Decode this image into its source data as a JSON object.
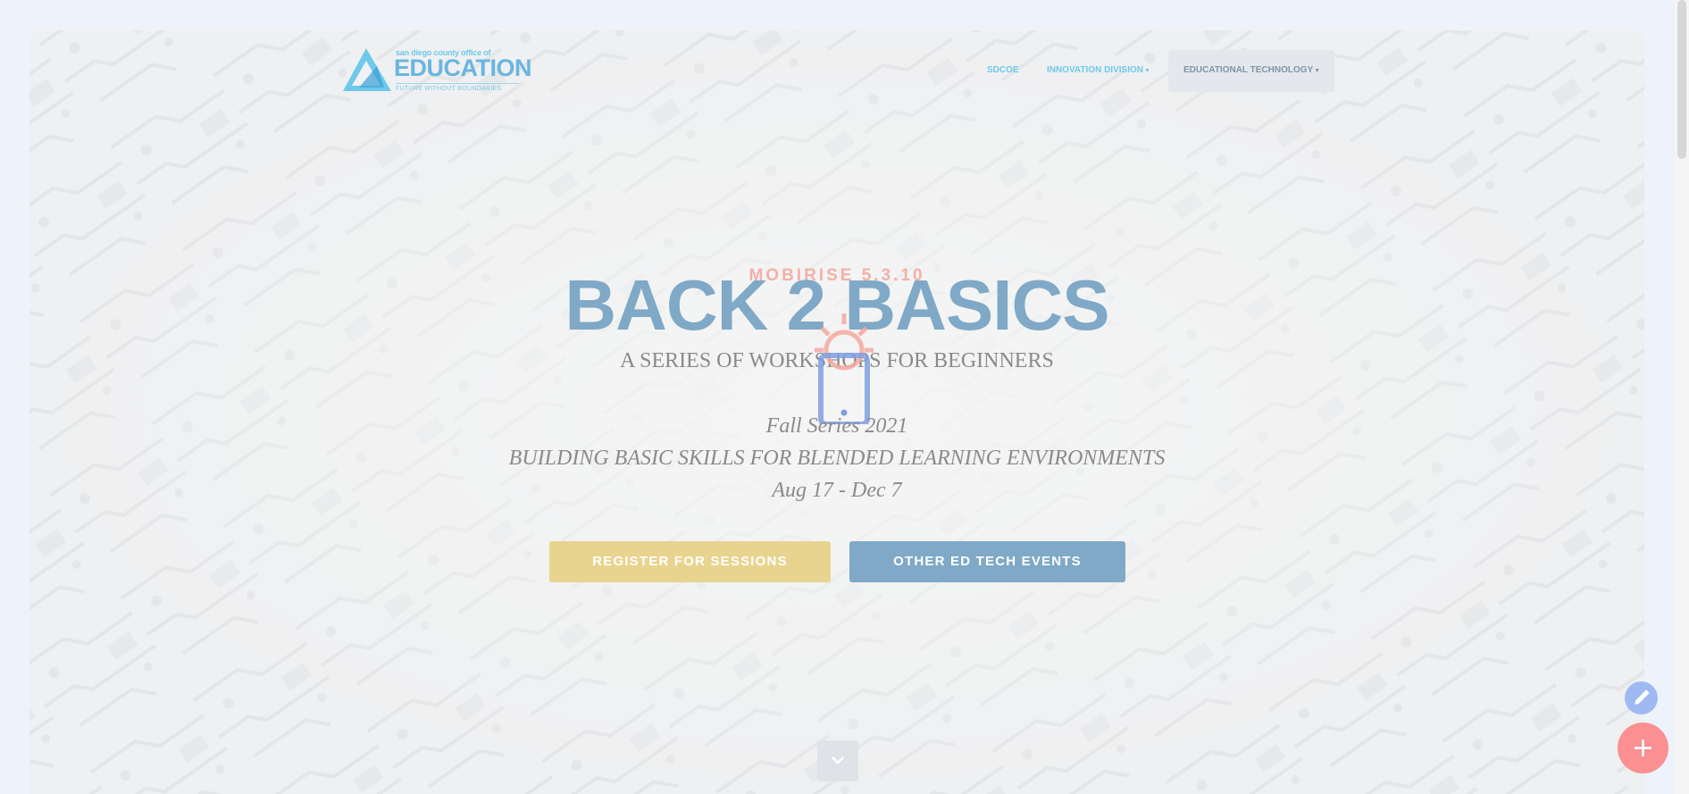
{
  "logo": {
    "top_text": "san diego county office of",
    "main_text": "EDUCATION",
    "tagline": "FUTURE WITHOUT BOUNDARIES"
  },
  "nav": {
    "items": [
      {
        "label": "SDCOE"
      },
      {
        "label": "INNOVATION DIVISION"
      },
      {
        "label": "EDUCATIONAL TECHNOLOGY"
      }
    ]
  },
  "hero": {
    "overlay_text": "MOBIRISE 5.3.10",
    "title": "BACK 2 BASICS",
    "subtitle": "A SERIES OF WORKSHOPS FOR BEGINNERS",
    "series": "Fall Series 2021",
    "theme": "BUILDING BASIC SKILLS FOR BLENDED LEARNING ENVIRONMENTS",
    "dates": "Aug 17 - Dec 7"
  },
  "buttons": {
    "register": "REGISTER FOR SESSIONS",
    "other": "OTHER ED TECH EVENTS"
  },
  "icons": {
    "scroll_down": "chevron-down-icon",
    "edit": "pencil-icon",
    "add": "plus-icon",
    "hero": "lightbulb-phone-icon"
  },
  "colors": {
    "title": "#7fa9c6",
    "register_button": "#e8d48f",
    "other_button": "#7fa9c6",
    "nav_link": "#6ec9ec",
    "fab_add": "#fb8f91",
    "fab_edit": "#9fb9f3"
  }
}
